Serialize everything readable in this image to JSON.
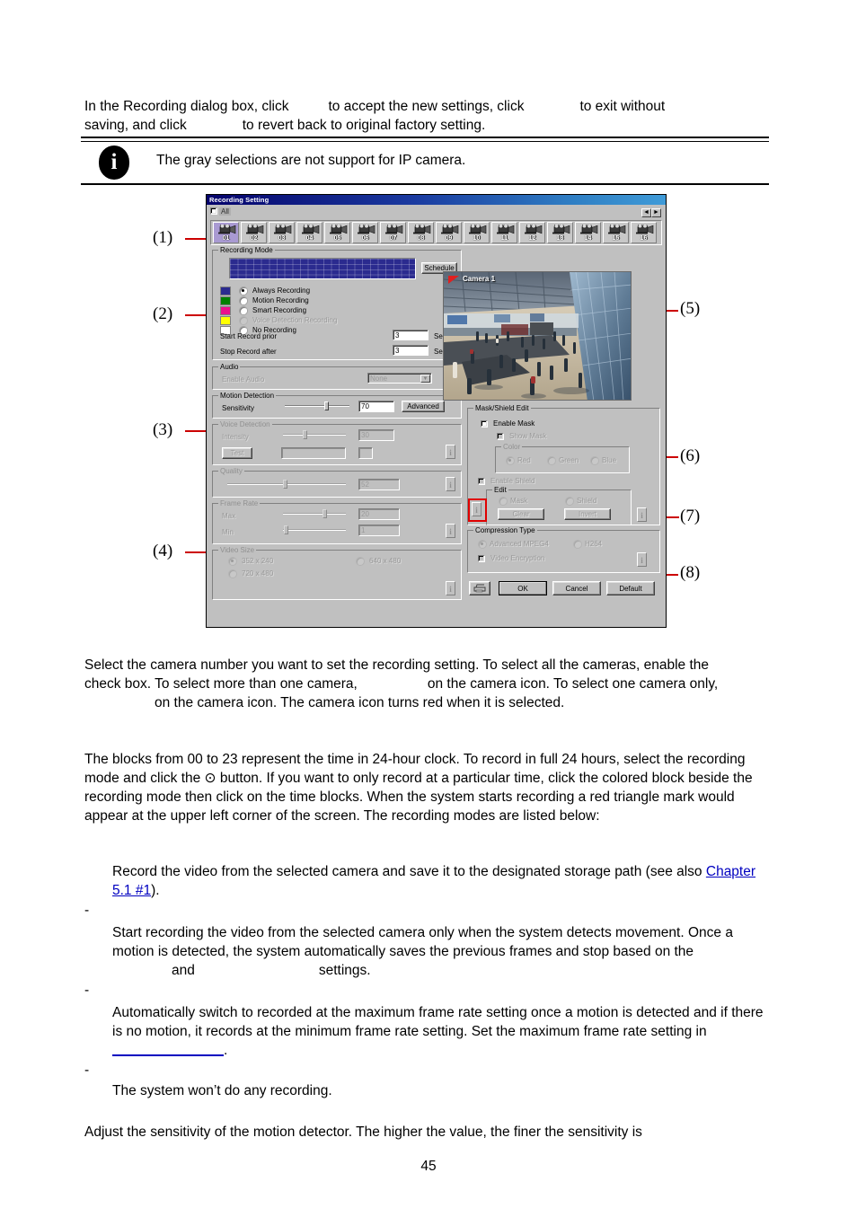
{
  "document": {
    "page_number": "45",
    "intro": {
      "line1_a": "In the Recording dialog box, click",
      "line1_b": "to accept the new settings, click",
      "line1_c": "to exit without",
      "line2_a": "saving, and click",
      "line2_b": "to revert back to original factory setting."
    },
    "note": {
      "icon": "info-icon",
      "glyph": "i",
      "text": "The gray selections are not support for IP camera."
    },
    "callouts": [
      {
        "label": "(1)"
      },
      {
        "label": "(2)"
      },
      {
        "label": "(3)"
      },
      {
        "label": "(4)"
      },
      {
        "label": "(5)"
      },
      {
        "label": "(6)"
      },
      {
        "label": "(7)"
      },
      {
        "label": "(8)"
      }
    ],
    "paragraphs": {
      "p1_a": "Select the camera number you want to set the recording setting. To select all the cameras, enable the",
      "p1_b": "check box. To select more than one camera,",
      "p1_c": "on the camera icon. To select one camera only,",
      "p1_d": "on the camera icon. The camera icon turns red when it is selected.",
      "p2": "The blocks from 00 to 23 represent the time in 24-hour clock. To record in full 24 hours, select the recording mode and click the ⊙ button. If you want to only record at a particular time, click the colored block beside the recording mode then click on the time blocks. When the system starts recording a red triangle mark would appear at the upper left corner of the screen. The recording modes are listed below:",
      "d1_a": "Record the video from the selected camera and save it to the designated storage path (see also ",
      "d1_link": "Chapter 5.1 #1",
      "d1_b": ").",
      "d2_a": "Start recording the video from the selected camera only when the system detects movement. Once a motion is detected, the system automatically saves the previous frames and stop based on the",
      "d2_b": "and",
      "d2_c": "settings.",
      "d3_a": "Automatically switch to recorded at the maximum frame rate setting once a motion is detected and if there is no motion, it records at the minimum frame rate setting. Set the maximum frame rate setting in",
      "d3_b": ".",
      "d4": "The system won’t do any recording.",
      "p3": "Adjust the sensitivity of the motion detector. The higher the value, the finer the sensitivity is",
      "dash": "-"
    }
  },
  "dialog": {
    "title": "Recording Setting",
    "all_checkbox_label": "All",
    "scroll_left": "◄",
    "scroll_right": "►",
    "cameras": [
      "01",
      "02",
      "03",
      "04",
      "05",
      "06",
      "07",
      "08",
      "09",
      "10",
      "11",
      "12",
      "13",
      "14",
      "15",
      "16"
    ],
    "selected_camera": "01",
    "recording_mode": {
      "legend": "Recording Mode",
      "schedule_button": "Schedule",
      "modes": [
        {
          "label": "Always Recording",
          "color": "#2b2b8f",
          "selected": true,
          "disabled": false
        },
        {
          "label": "Motion Recording",
          "color": "#008000",
          "selected": false,
          "disabled": false
        },
        {
          "label": "Smart Recording",
          "color": "#ec0f8c",
          "selected": false,
          "disabled": false
        },
        {
          "label": "Voice Detection Recording",
          "color": "#ffff00",
          "selected": false,
          "disabled": true
        },
        {
          "label": "No Recording",
          "color": "#ffffff",
          "selected": false,
          "disabled": false
        }
      ],
      "start_record_prior_label": "Start Record prior",
      "start_record_prior_value": "3",
      "start_record_prior_unit": "Sec.",
      "stop_record_after_label": "Stop Record after",
      "stop_record_after_value": "3",
      "stop_record_after_unit": "Sec."
    },
    "audio": {
      "legend": "Audio",
      "enable_audio_label": "Enable Audio",
      "enable_audio_value": "None"
    },
    "motion_detection": {
      "legend": "Motion Detection",
      "sensitivity_label": "Sensitivity",
      "sensitivity_value": "70",
      "advanced_button": "Advanced"
    },
    "voice_detection": {
      "legend": "Voice Detection",
      "intensity_label": "Intensity",
      "intensity_value": "30",
      "test_button": "Test"
    },
    "quality": {
      "legend": "Quality",
      "value": "52"
    },
    "frame_rate": {
      "legend": "Frame Rate",
      "max_label": "Max",
      "max_value": "20",
      "min_label": "Min",
      "min_value": "1"
    },
    "video_size": {
      "legend": "Video Size",
      "options": [
        {
          "label": "352 x 240",
          "selected": true
        },
        {
          "label": "640 x 480",
          "selected": false
        },
        {
          "label": "720 x 480",
          "selected": false
        }
      ]
    },
    "preview": {
      "camera_label": "Camera  1"
    },
    "mask_shield": {
      "legend": "Mask/Shield Edit",
      "enable_mask_label": "Enable Mask",
      "show_mask_label": "Show Mask",
      "color_legend": "Color",
      "colors": [
        {
          "label": "Red",
          "selected": true
        },
        {
          "label": "Green",
          "selected": false
        },
        {
          "label": "Blue",
          "selected": false
        }
      ],
      "enable_shield_label": "Enable Shield",
      "edit_legend": "Edit",
      "edit_options": [
        {
          "label": "Mask",
          "selected": false
        },
        {
          "label": "Shield",
          "selected": false
        }
      ],
      "clear_button": "Clear",
      "invert_button": "Invert"
    },
    "compression": {
      "legend": "Compression Type",
      "options": [
        {
          "label": "Advanced MPEG4",
          "selected": true
        },
        {
          "label": "H264",
          "selected": false
        }
      ],
      "video_encryption_label": "Video Encryption"
    },
    "buttons": {
      "print_icon": "printer-icon",
      "ok": "OK",
      "cancel": "Cancel",
      "default": "Default"
    },
    "info_icon_glyph": "i"
  }
}
